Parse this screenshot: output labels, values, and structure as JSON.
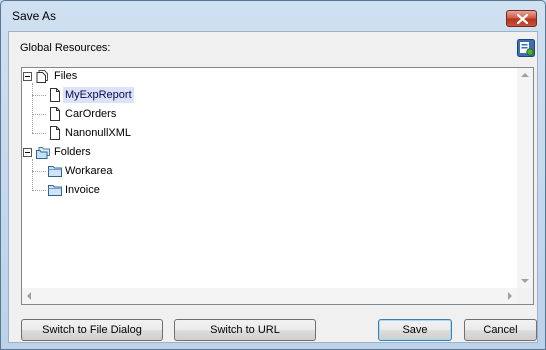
{
  "window": {
    "title": "Save As"
  },
  "panel": {
    "label": "Global Resources:"
  },
  "tree": {
    "files_label": "Files",
    "files": [
      "MyExpReport",
      "CarOrders",
      "NanonullXML"
    ],
    "selected": "MyExpReport",
    "folders_label": "Folders",
    "folders": [
      "Workarea",
      "Invoice"
    ]
  },
  "buttons": {
    "switch_file": "Switch to File Dialog",
    "switch_url": "Switch to URL",
    "save": "Save",
    "cancel": "Cancel"
  },
  "icons": {
    "close": "close-icon",
    "resources": "resources-icon",
    "file": "file-icon",
    "folder": "folder-icon"
  }
}
